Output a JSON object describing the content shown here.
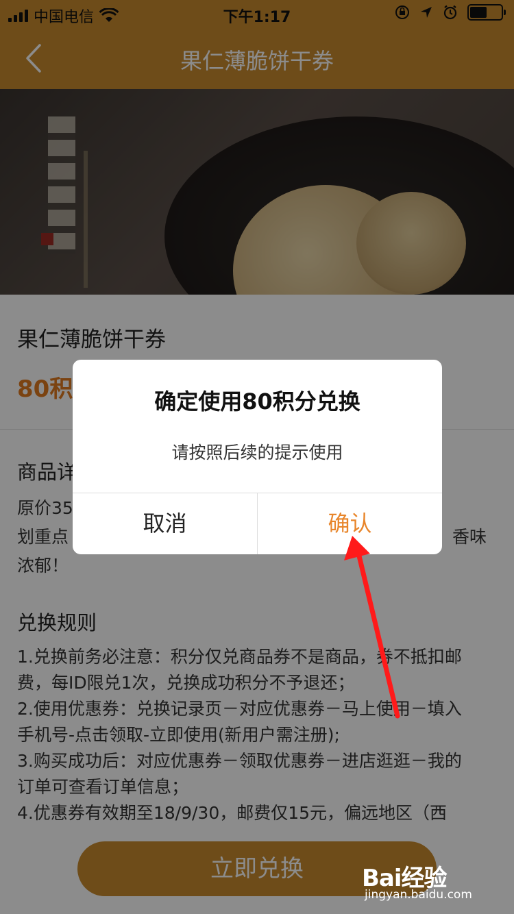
{
  "status_bar": {
    "carrier": "中国电信",
    "time": "下午1:17"
  },
  "nav": {
    "title": "果仁薄脆饼干券"
  },
  "product": {
    "name": "果仁薄脆饼干券",
    "points_visible": "80积"
  },
  "details": {
    "title_visible": "商品详",
    "line1_left": "原价35",
    "line2_left": "划重点",
    "line2_right": "香味",
    "line3": "浓郁！"
  },
  "rules": {
    "title": "兑换规则",
    "lines": [
      "1.兑换前务必注意：积分仅兑商品券不是商品，券不抵扣邮",
      "费，每ID限兑1次，兑换成功积分不予退还；",
      "2.使用优惠券：兑换记录页－对应优惠券－马上使用－填入",
      "手机号-点击领取-立即使用(新用户需注册);",
      "3.购买成功后：对应优惠券－领取优惠券－进店逛逛－我的",
      "订单可查看订单信息；",
      "4.优惠券有效期至18/9/30，邮费仅15元，偏远地区（西"
    ]
  },
  "bottom": {
    "redeem_label": "立即兑换"
  },
  "dialog": {
    "title": "确定使用80积分兑换",
    "message": "请按照后续的提示使用",
    "cancel_label": "取消",
    "confirm_label": "确认"
  },
  "watermark": {
    "logo": "Bai经验",
    "url": "jingyan.baidu.com"
  },
  "colors": {
    "brand": "#c88a2e",
    "accent": "#e8852a",
    "points": "#e07a20",
    "annotation_arrow": "#ff1a1a"
  }
}
